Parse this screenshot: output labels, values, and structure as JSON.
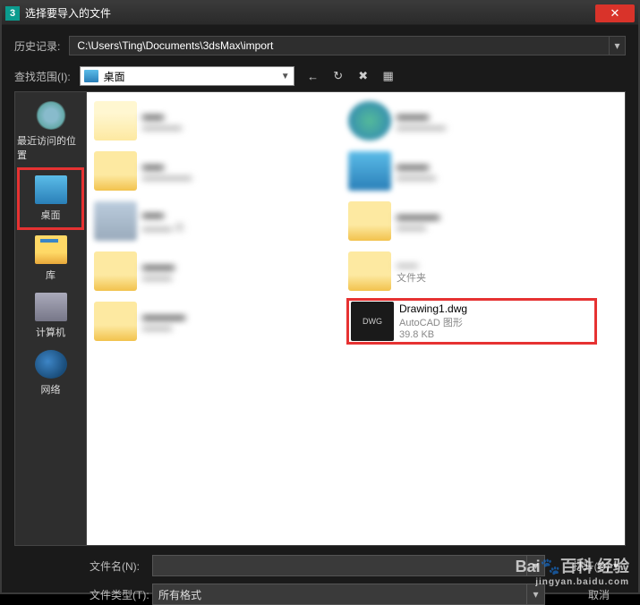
{
  "window": {
    "app_badge": "3",
    "title": "选择要导入的文件",
    "close": "✕"
  },
  "history": {
    "label": "历史记录:",
    "path": "C:\\Users\\Ting\\Documents\\3dsMax\\import",
    "arrow": "▾"
  },
  "lookin": {
    "label": "查找范围(I):",
    "value": "桌面",
    "arrow": "▼"
  },
  "toolbar": {
    "back": "←",
    "up": "↻",
    "new": "✖",
    "views": "▦"
  },
  "sidebar": [
    {
      "label": "最近访问的位置"
    },
    {
      "label": "桌面"
    },
    {
      "label": "库"
    },
    {
      "label": "计算机"
    },
    {
      "label": "网络"
    }
  ],
  "files": {
    "dwg": {
      "name": "Drawing1.dwg",
      "type": "AutoCAD 图形",
      "size": "39.8 KB"
    },
    "folder_sub": "文件夹"
  },
  "bottom": {
    "filename_label": "文件名(N):",
    "filetype_label": "文件类型(T):",
    "filetype_value": "所有格式",
    "open_label": "打开(O)",
    "cancel_label": "取消"
  },
  "watermark": {
    "main": "Bai🐾百科 经验",
    "sub": "jingyan.baidu.com"
  }
}
